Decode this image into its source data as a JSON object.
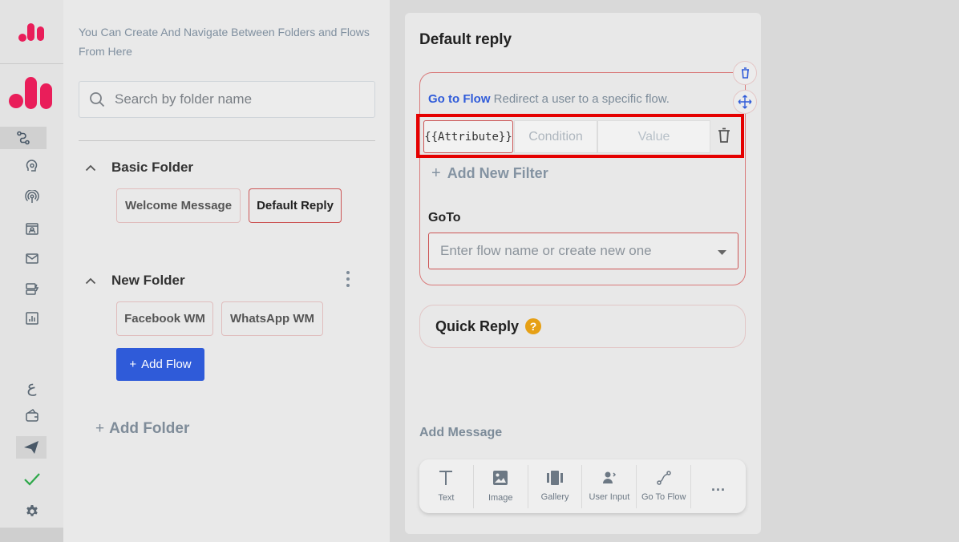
{
  "colors": {
    "brand": "#e91e5a",
    "link_blue": "#2f5bd9",
    "highlight_red": "#e50000",
    "active_border": "#cc5555",
    "help_amber": "#e6a015",
    "success_green": "#2ea84a"
  },
  "rail": {
    "icons": [
      "logo-icon",
      "brand-logo-icon",
      "flows-icon",
      "ai-brain-icon",
      "broadcast-icon",
      "contacts-icon",
      "mail-icon",
      "inbox-icon",
      "analytics-icon",
      "arabic-language-icon",
      "wallet-icon",
      "send-icon",
      "check-icon",
      "settings-icon"
    ],
    "language_glyph": "ع"
  },
  "panel": {
    "hint": "You Can Create And Navigate Between Folders and Flows From Here",
    "search_placeholder": "Search by folder name",
    "folders": [
      {
        "name": "Basic Folder",
        "flows": [
          "Welcome Message",
          "Default Reply"
        ]
      },
      {
        "name": "New Folder",
        "flows": [
          "Facebook WM",
          "WhatsApp WM"
        ]
      }
    ],
    "add_flow_label": "Add Flow",
    "add_folder_label": "Add Folder"
  },
  "editor": {
    "title": "Default reply",
    "goto_card": {
      "link_text": "Go to Flow",
      "description": "Redirect a user to a specific flow.",
      "filter": {
        "attribute": "{{Attribute}}",
        "condition": "Condition",
        "value": "Value"
      },
      "add_filter_label": "Add New Filter",
      "goto_label": "GoTo",
      "goto_placeholder": "Enter flow name or create new one"
    },
    "quick_reply_label": "Quick Reply",
    "quick_reply_help": "?",
    "add_message_label": "Add Message",
    "tools": [
      "Text",
      "Image",
      "Gallery",
      "User Input",
      "Go To Flow"
    ],
    "more_label": "..."
  }
}
